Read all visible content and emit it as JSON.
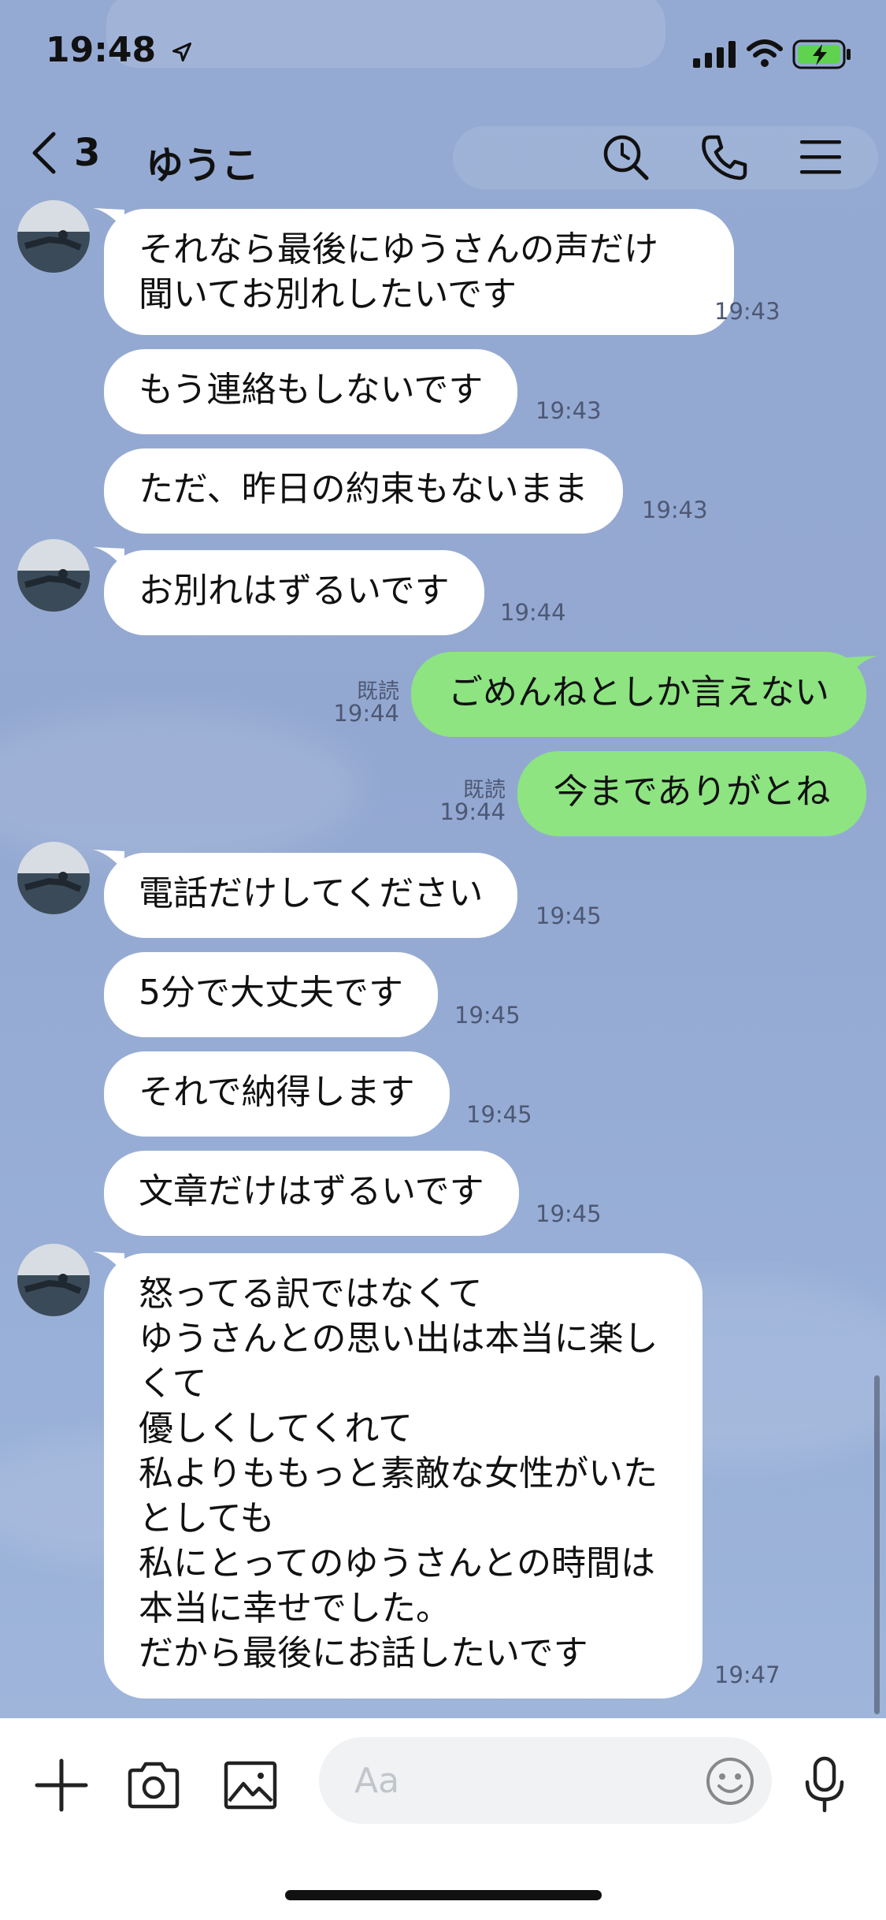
{
  "status_bar": {
    "time": "19:48"
  },
  "header": {
    "unread_count": "3",
    "title": "ゆうこ"
  },
  "messages": [
    {
      "direction": "in",
      "text": "それなら最後にゆうさんの声だけ\n聞いてお別れしたいです",
      "time": "19:43"
    },
    {
      "direction": "in",
      "text": "もう連絡もしないです",
      "time": "19:43"
    },
    {
      "direction": "in",
      "text": "ただ、昨日の約束もないまま",
      "time": "19:43"
    },
    {
      "direction": "in",
      "text": "お別れはずるいです",
      "time": "19:44"
    },
    {
      "direction": "out",
      "text": "ごめんねとしか言えない",
      "read": "既読",
      "time": "19:44"
    },
    {
      "direction": "out",
      "text": "今までありがとね",
      "read": "既読",
      "time": "19:44"
    },
    {
      "direction": "in",
      "text": "電話だけしてください",
      "time": "19:45"
    },
    {
      "direction": "in",
      "text": "5分で大丈夫です",
      "time": "19:45"
    },
    {
      "direction": "in",
      "text": "それで納得します",
      "time": "19:45"
    },
    {
      "direction": "in",
      "text": "文章だけはずるいです",
      "time": "19:45"
    },
    {
      "direction": "in",
      "text": "怒ってる訳ではなくて\nゆうさんとの思い出は本当に楽し\nくて\n優しくしてくれて\n私よりももっと素敵な女性がいた\nとしても\n私にとってのゆうさんとの時間は\n本当に幸せでした。\nだから最後にお話したいです",
      "time": "19:47"
    }
  ],
  "input": {
    "placeholder": "Aa"
  },
  "colors": {
    "chat_background": "#93a9d2",
    "outgoing_bubble": "#8de481",
    "incoming_bubble": "#ffffff"
  },
  "icons": [
    "back-chevron-icon",
    "search-icon",
    "phone-icon",
    "menu-icon",
    "plus-icon",
    "camera-icon",
    "image-icon",
    "emoji-icon",
    "microphone-icon"
  ]
}
